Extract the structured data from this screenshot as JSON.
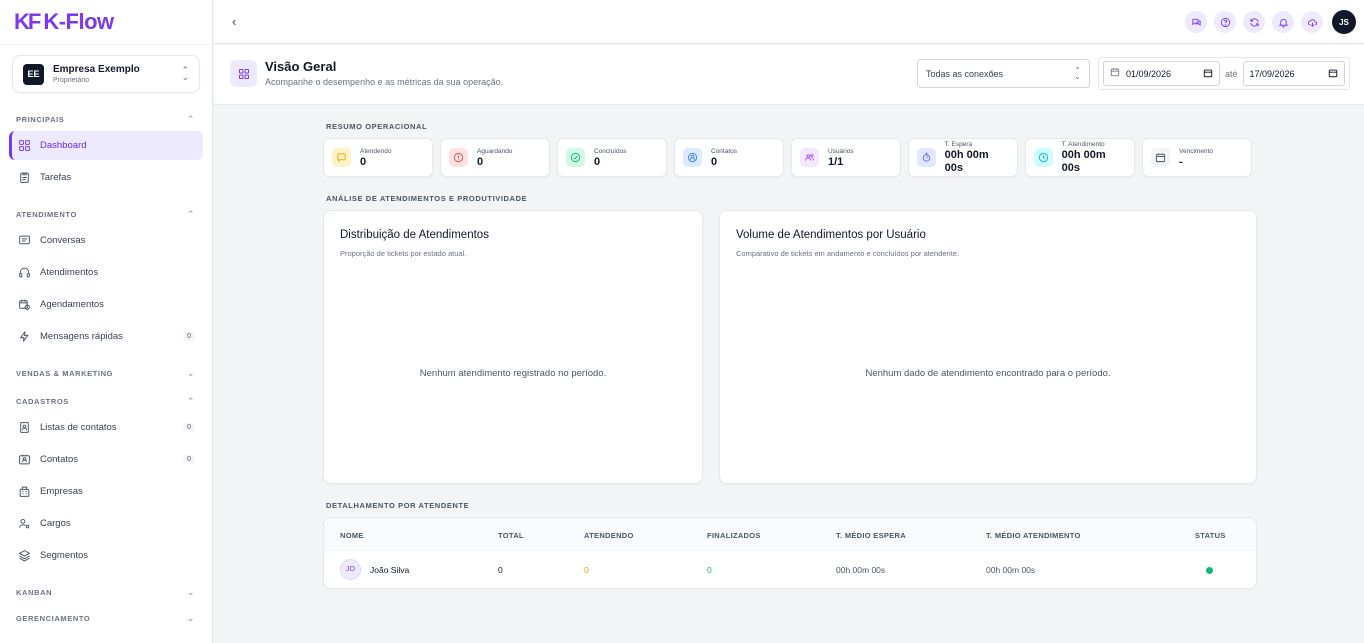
{
  "brand": {
    "mark": "KF",
    "name": "K-Flow",
    "accent": "#7c3aed"
  },
  "company": {
    "initials": "EE",
    "name": "Empresa Exemplo",
    "role": "Proprietário"
  },
  "sidebar": {
    "sections": [
      {
        "title": "PRINCIPAIS",
        "expanded": true,
        "items": [
          {
            "label": "Dashboard",
            "icon": "dashboard-icon",
            "active": true
          },
          {
            "label": "Tarefas",
            "icon": "clipboard-icon"
          }
        ]
      },
      {
        "title": "ATENDIMENTO",
        "expanded": true,
        "items": [
          {
            "label": "Conversas",
            "icon": "chat-lines-icon"
          },
          {
            "label": "Atendimentos",
            "icon": "headset-icon"
          },
          {
            "label": "Agendamentos",
            "icon": "calendar-clock-icon"
          },
          {
            "label": "Mensagens rápidas",
            "icon": "lightning-icon",
            "count": "0"
          }
        ]
      },
      {
        "title": "VENDAS & MARKETING",
        "expanded": false,
        "items": []
      },
      {
        "title": "CADASTROS",
        "expanded": true,
        "items": [
          {
            "label": "Listas de contatos",
            "icon": "contact-book-icon",
            "count": "0"
          },
          {
            "label": "Contatos",
            "icon": "contact-card-icon",
            "count": "0"
          },
          {
            "label": "Empresas",
            "icon": "building-icon"
          },
          {
            "label": "Cargos",
            "icon": "user-cog-icon"
          },
          {
            "label": "Segmentos",
            "icon": "layers-icon"
          }
        ]
      },
      {
        "title": "KANBAN",
        "expanded": false,
        "items": []
      },
      {
        "title": "GERENCIAMENTO",
        "expanded": false,
        "items": []
      }
    ]
  },
  "topbar": {
    "icons": [
      "chat-icon",
      "help-icon",
      "refresh-icon",
      "bell-icon",
      "cloud-download-icon"
    ],
    "user_initials": "JS"
  },
  "page": {
    "title": "Visão Geral",
    "subtitle": "Acompanhe o desempenho e as métricas da sua operação.",
    "connection_filter": "Todas as conexões",
    "date_from": "01/09/2026",
    "date_sep": "até",
    "date_to": "17/09/2026"
  },
  "summary": {
    "label": "RESUMO OPERACIONAL",
    "stats": [
      {
        "label": "Atendendo",
        "value": "0",
        "icon": "chat-square-icon",
        "color": "#f59e0b",
        "bg": "#fef3c7"
      },
      {
        "label": "Aguardando",
        "value": "0",
        "icon": "alert-circle-icon",
        "color": "#ef4444",
        "bg": "#fee2e2"
      },
      {
        "label": "Concluídos",
        "value": "0",
        "icon": "check-circle-icon",
        "color": "#10b981",
        "bg": "#d1fae5"
      },
      {
        "label": "Contatos",
        "value": "0",
        "icon": "user-circle-icon",
        "color": "#3b82f6",
        "bg": "#dbeafe"
      },
      {
        "label": "Usuários",
        "value": "1/1",
        "icon": "users-icon",
        "color": "#a855f7",
        "bg": "#f3e8ff"
      },
      {
        "label": "T. Espera",
        "value": "00h 00m 00s",
        "icon": "stopwatch-icon",
        "color": "#6366f1",
        "bg": "#e0e7ff"
      },
      {
        "label": "T. Atendimento",
        "value": "00h 00m 00s",
        "icon": "clock-icon",
        "color": "#06b6d4",
        "bg": "#cffafe"
      },
      {
        "label": "Vencimento",
        "value": "-",
        "icon": "calendar-icon",
        "color": "#4b5563",
        "bg": "#f3f4f6"
      }
    ]
  },
  "analysis": {
    "label": "ANÁLISE DE ATENDIMENTOS E PRODUTIVIDADE",
    "distribution": {
      "title": "Distribuição de Atendimentos",
      "subtitle": "Proporção de tickets por estado atual.",
      "empty": "Nenhum atendimento registrado no período."
    },
    "volume": {
      "title": "Volume de Atendimentos por Usuário",
      "subtitle": "Comparativo de tickets em andamento e concluídos por atendente.",
      "empty": "Nenhum dado de atendimento encontrado para o período."
    }
  },
  "detail": {
    "label": "DETALHAMENTO POR ATENDENTE",
    "columns": [
      "NOME",
      "TOTAL",
      "ATENDENDO",
      "FINALIZADOS",
      "T. MÉDIO ESPERA",
      "T. MÉDIO ATENDIMENTO",
      "STATUS"
    ],
    "rows": [
      {
        "initials": "JO",
        "name": "João Silva",
        "total": "0",
        "atendendo": "0",
        "finalizados": "0",
        "espera": "00h 00m 00s",
        "atendimento": "00h 00m 00s",
        "status_color": "#10b981"
      }
    ]
  }
}
